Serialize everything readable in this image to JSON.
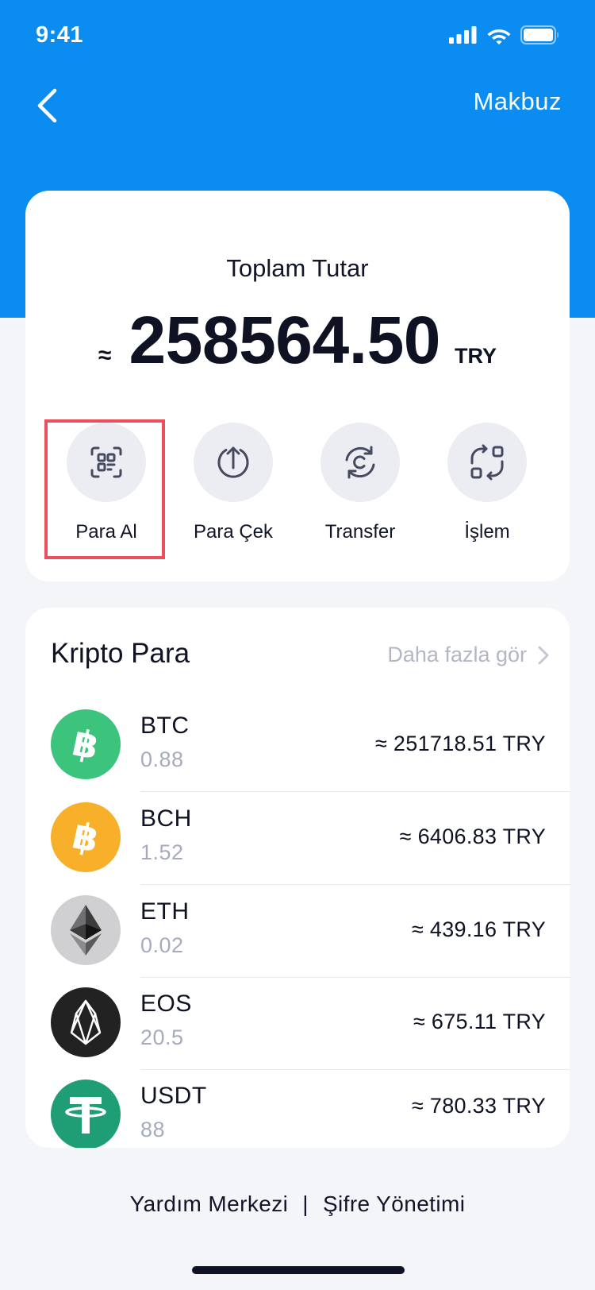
{
  "status_bar": {
    "time": "9:41"
  },
  "header": {
    "receipt_label": "Makbuz"
  },
  "balance": {
    "label": "Toplam Tutar",
    "approx_symbol": "≈",
    "amount": "258564.50",
    "currency": "TRY"
  },
  "actions": [
    {
      "label": "Para Al",
      "icon": "qr-scan-icon",
      "highlighted": true
    },
    {
      "label": "Para Çek",
      "icon": "upload-icon"
    },
    {
      "label": "Transfer",
      "icon": "transfer-c-icon"
    },
    {
      "label": "İşlem",
      "icon": "exchange-icon"
    }
  ],
  "crypto": {
    "title": "Kripto Para",
    "see_more": "Daha fazla gör",
    "coins": [
      {
        "symbol": "BTC",
        "amount": "0.88",
        "value": "≈ 251718.51 TRY",
        "color": "#3cc47c",
        "icon": "bitcoin-icon"
      },
      {
        "symbol": "BCH",
        "amount": "1.52",
        "value": "≈ 6406.83 TRY",
        "color": "#f8b02a",
        "icon": "bitcoin-cash-icon"
      },
      {
        "symbol": "ETH",
        "amount": "0.02",
        "value": "≈ 439.16 TRY",
        "color": "#d0d0d2",
        "icon": "ethereum-icon"
      },
      {
        "symbol": "EOS",
        "amount": "20.5",
        "value": "≈ 675.11 TRY",
        "color": "#222222",
        "icon": "eos-icon"
      },
      {
        "symbol": "USDT",
        "amount": "88",
        "value": "≈ 780.33 TRY",
        "color": "#1f9d74",
        "icon": "tether-icon"
      }
    ]
  },
  "footer": {
    "help_center": "Yardım Merkezi",
    "separator": "|",
    "password_management": "Şifre Yönetimi"
  },
  "colors": {
    "header_blue": "#0a8cf0",
    "highlight_red": "#e9505b",
    "background": "#f4f5f9"
  }
}
